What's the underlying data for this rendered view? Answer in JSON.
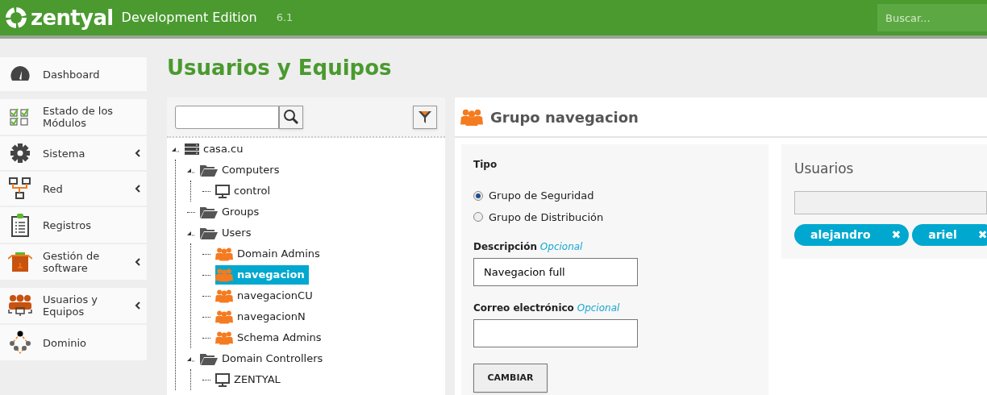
{
  "header": {
    "logo": "zentyal",
    "edition": "Development Edition",
    "version": "6.1",
    "search": {
      "placeholder": "Buscar..."
    }
  },
  "sidebar": {
    "groups": [
      {
        "items": [
          {
            "label": "Dashboard",
            "kind": "dashboard",
            "submenu": false
          }
        ]
      },
      {
        "items": [
          {
            "label": "Estado de los Módulos",
            "kind": "modules",
            "submenu": false
          },
          {
            "label": "Sistema",
            "kind": "system",
            "submenu": true
          },
          {
            "label": "Red",
            "kind": "network",
            "submenu": true
          },
          {
            "label": "Registros",
            "kind": "logs",
            "submenu": false
          },
          {
            "label": "Gestión de software",
            "kind": "software",
            "submenu": true
          }
        ]
      },
      {
        "items": [
          {
            "label": "Usuarios y Equipos",
            "kind": "users",
            "submenu": true
          },
          {
            "label": "Dominio",
            "kind": "domain",
            "submenu": false
          }
        ]
      }
    ]
  },
  "page_title": "Usuarios y Equipos",
  "tree": {
    "nodes": [
      {
        "label": "casa.cu",
        "kind": "domain",
        "expanded": true,
        "selected": false,
        "children": [
          {
            "label": "Computers",
            "kind": "folder",
            "expanded": true,
            "selected": false,
            "children": [
              {
                "label": "control",
                "kind": "computer",
                "expanded": false,
                "selected": false
              }
            ]
          },
          {
            "label": "Groups",
            "kind": "folder",
            "expanded": false,
            "selected": false
          },
          {
            "label": "Users",
            "kind": "folder",
            "expanded": true,
            "selected": false,
            "children": [
              {
                "label": "Domain Admins",
                "kind": "group",
                "expanded": false,
                "selected": false
              },
              {
                "label": "navegacion",
                "kind": "group",
                "expanded": false,
                "selected": true
              },
              {
                "label": "navegacionCU",
                "kind": "group",
                "expanded": false,
                "selected": false
              },
              {
                "label": "navegacionN",
                "kind": "group",
                "expanded": false,
                "selected": false
              },
              {
                "label": "Schema Admins",
                "kind": "group",
                "expanded": false,
                "selected": false
              }
            ]
          },
          {
            "label": "Domain Controllers",
            "kind": "folder",
            "expanded": true,
            "selected": false,
            "children": [
              {
                "label": "ZENTYAL",
                "kind": "computer",
                "expanded": false,
                "selected": false
              }
            ]
          }
        ]
      }
    ]
  },
  "detail": {
    "title": "Grupo navegacion",
    "form": {
      "type_label": "Tipo",
      "options": [
        {
          "label": "Grupo de Seguridad",
          "selected": true
        },
        {
          "label": "Grupo de Distribución",
          "selected": false
        }
      ],
      "fields": [
        {
          "label": "Descripción",
          "hint": "Opcional",
          "value": "Navegacion full"
        },
        {
          "label": "Correo electrónico",
          "hint": "Opcional"
        }
      ],
      "button": "CAMBIAR"
    },
    "members": {
      "title": "Usuarios",
      "tags": [
        {
          "label": "alejandro",
          "remove": "✖"
        },
        {
          "label": "ariel",
          "remove": "✖"
        }
      ]
    }
  }
}
